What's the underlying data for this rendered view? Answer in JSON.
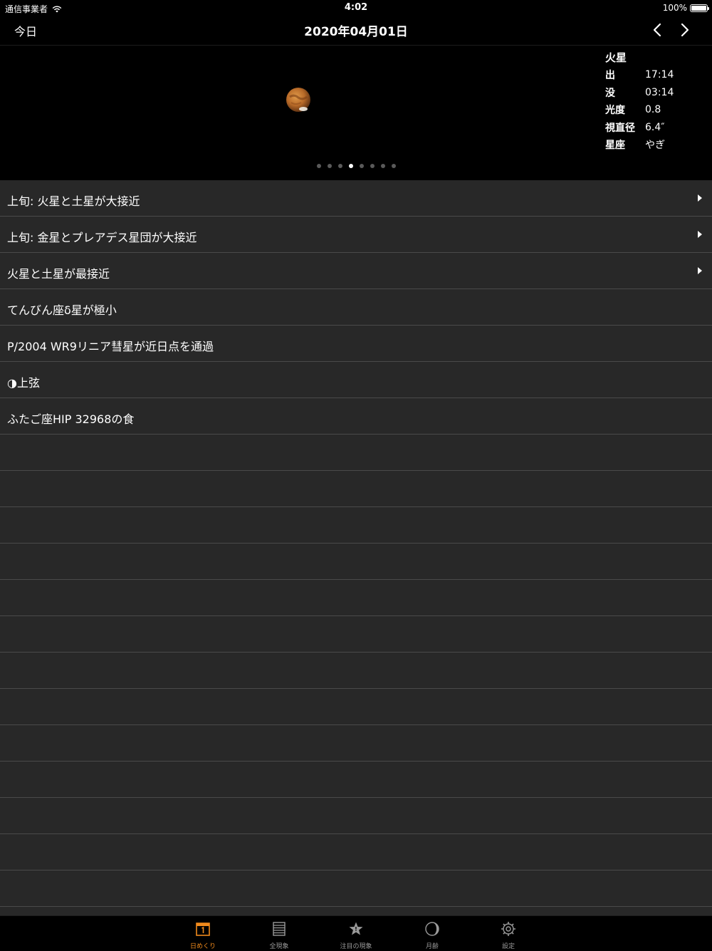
{
  "status_bar": {
    "carrier": "通信事業者",
    "time": "4:02",
    "battery": "100%"
  },
  "nav": {
    "today_label": "今日",
    "title": "2020年04月01日"
  },
  "planet_info": {
    "name": "火星",
    "rows": [
      {
        "label": "出",
        "value": "17:14"
      },
      {
        "label": "没",
        "value": "03:14"
      },
      {
        "label": "光度",
        "value": "0.8"
      },
      {
        "label": "視直径",
        "value": "6.4″"
      },
      {
        "label": "星座",
        "value": "やぎ"
      }
    ]
  },
  "page_indicator": {
    "count": 8,
    "current": 4
  },
  "events": [
    {
      "label": "上旬: 火星と土星が大接近",
      "has_detail": true
    },
    {
      "label": "上旬: 金星とプレアデス星団が大接近",
      "has_detail": true
    },
    {
      "label": "火星と土星が最接近",
      "has_detail": true
    },
    {
      "label": "てんびん座δ星が極小",
      "has_detail": false
    },
    {
      "label": "P/2004 WR9リニア彗星が近日点を通過",
      "has_detail": false
    },
    {
      "label": "◑上弦",
      "has_detail": false
    },
    {
      "label": "ふたご座HIP 32968の食",
      "has_detail": false
    }
  ],
  "empty_rows": 13,
  "tabs": [
    {
      "label": "日めくり",
      "icon": "calendar-icon",
      "active": true
    },
    {
      "label": "全現象",
      "icon": "list-icon",
      "active": false
    },
    {
      "label": "注目の現象",
      "icon": "star-icon",
      "active": false
    },
    {
      "label": "月齢",
      "icon": "moon-icon",
      "active": false
    },
    {
      "label": "設定",
      "icon": "gear-icon",
      "active": false
    }
  ],
  "colors": {
    "accent": "#f08a1c",
    "background": "#000000",
    "row_background": "#282828",
    "separator": "#4a4a4a"
  }
}
